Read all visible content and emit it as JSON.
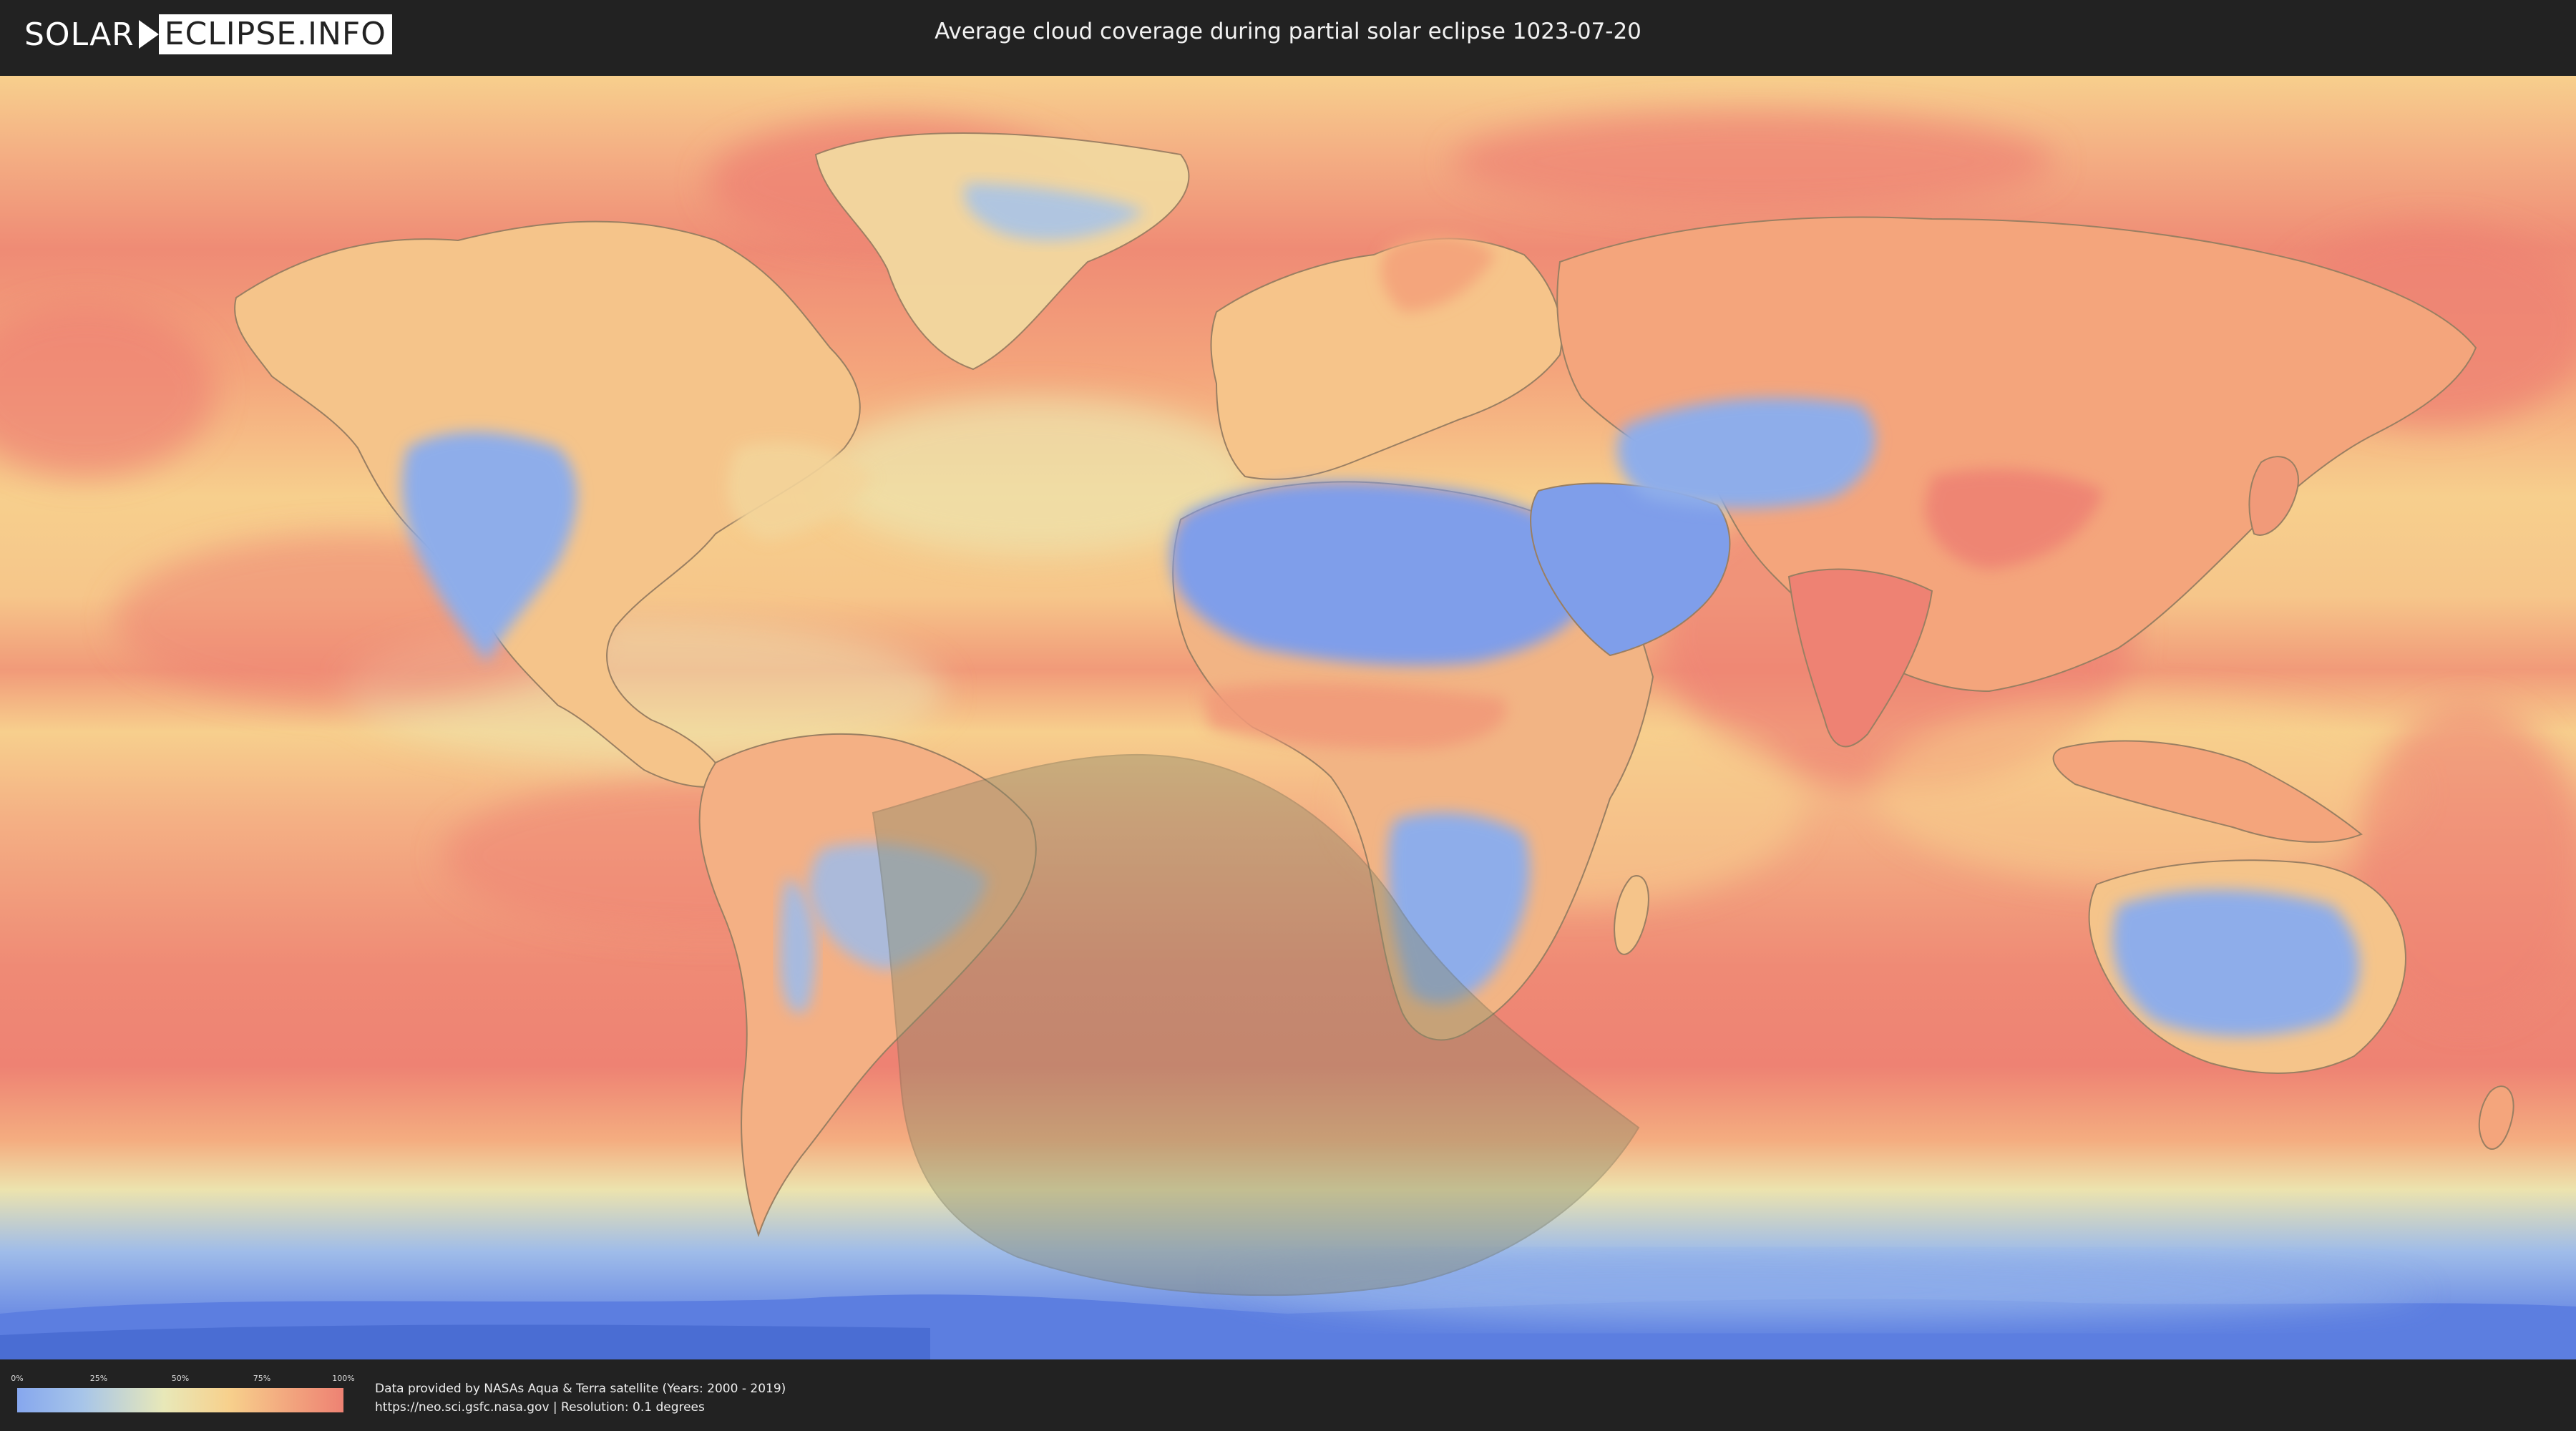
{
  "header": {
    "logo_left": "SOLAR",
    "logo_right": "ECLIPSE.INFO",
    "title": "Average cloud coverage during partial solar eclipse 1023-07-20"
  },
  "legend": {
    "ticks": [
      "0%",
      "25%",
      "50%",
      "75%",
      "100%"
    ],
    "tick_values": [
      0,
      25,
      50,
      75,
      100
    ],
    "colors": [
      "#86a7ee",
      "#a7c5e9",
      "#e8e8b8",
      "#f7d08c",
      "#f2a27d",
      "#ee8273"
    ]
  },
  "credits": {
    "line1": "Data provided by NASAs Aqua & Terra satellite (Years: 2000 - 2019)",
    "line2": "https://neo.sci.gsfc.nasa.gov | Resolution: 0.1 degrees"
  },
  "map": {
    "colors": {
      "high_cloud": "#ee8273",
      "mid_high": "#f4a57c",
      "mid": "#f7cf8d",
      "low_mid": "#ece3ae",
      "low": "#9fbce9",
      "clear": "#7f9eea",
      "antarctic_ice": "#5c7ee0",
      "eclipse_zone": "#8a8a6a"
    }
  }
}
